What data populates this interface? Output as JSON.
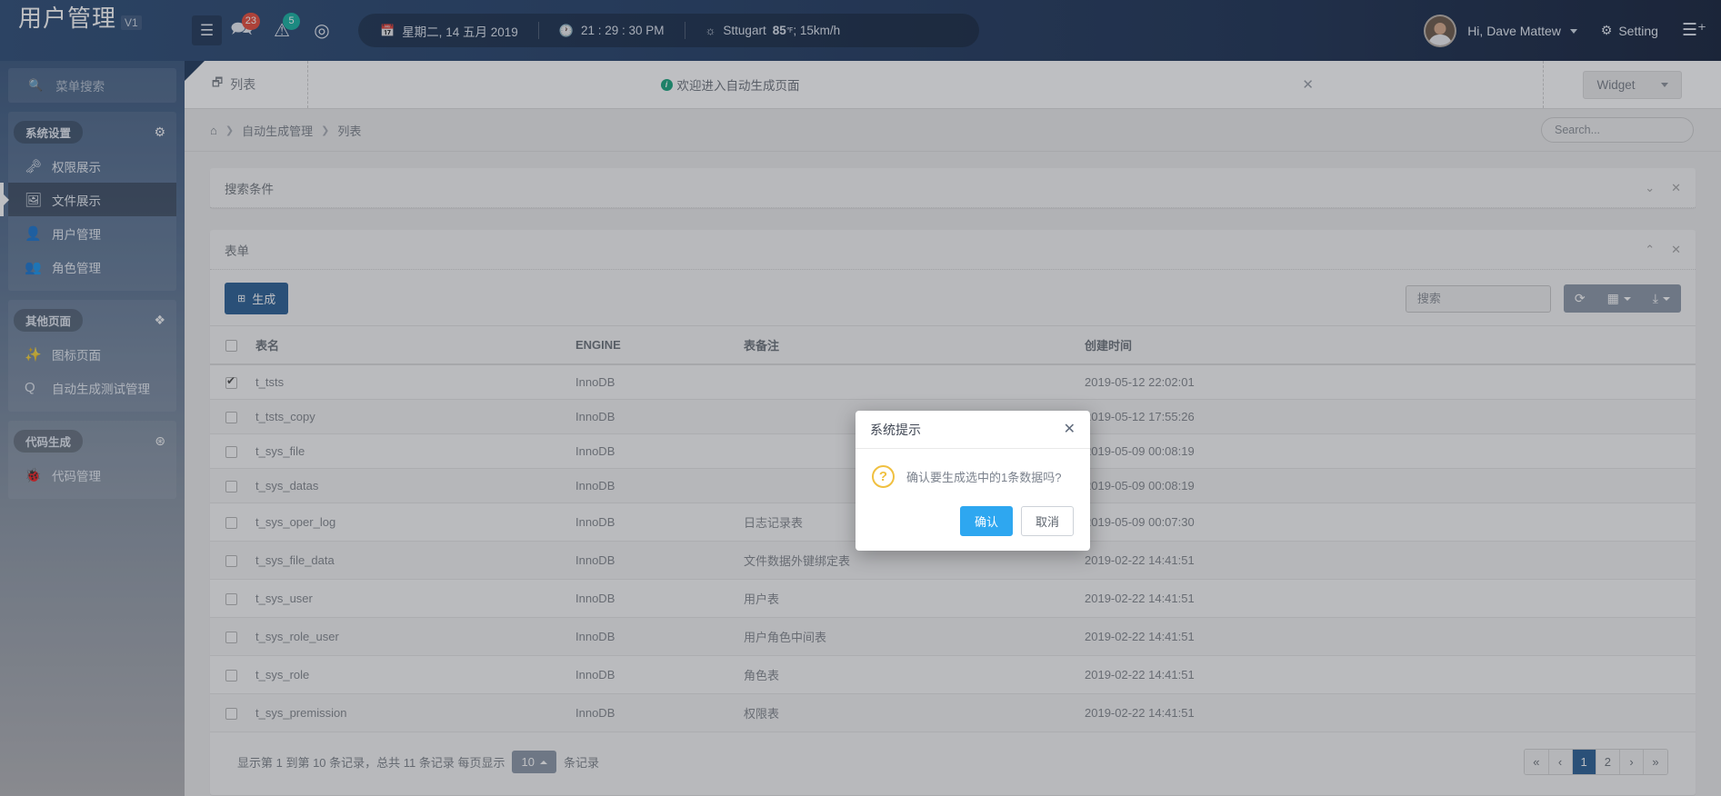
{
  "header": {
    "brand_title": "用户管理",
    "brand_version": "V1",
    "hamburger_icon": "hamburger-icon",
    "messages": {
      "icon": "comments-icon",
      "badge": "23"
    },
    "alerts": {
      "icon": "warning-triangle-icon",
      "badge": "5"
    },
    "settings_icon": "lifebuoy-icon",
    "info": {
      "date_icon": "calendar-icon",
      "date": "星期二, 14 五月 2019",
      "time_icon": "clock-icon",
      "time": "21 : 29 : 30 PM",
      "weather_icon": "sun-icon",
      "weather_city": "Sttugart",
      "weather_temp": "85",
      "weather_unit": "℉",
      "weather_wind": "; 15km/h"
    },
    "avatar_name": "avatar",
    "user_greeting": "Hi, Dave Mattew",
    "setting_label": "Setting",
    "setting_icon": "gear-icon",
    "plus_icon": "list-plus-icon"
  },
  "sidebar": {
    "search_placeholder": "菜单搜索",
    "search_icon": "menu-search-icon",
    "groups": [
      {
        "title": "系统设置",
        "icon": "gear-icon",
        "items": [
          {
            "label": "权限展示",
            "icon": "key-icon",
            "active": false
          },
          {
            "label": "文件展示",
            "icon": "file-image-icon",
            "active": true
          },
          {
            "label": "用户管理",
            "icon": "user-icon",
            "active": false
          },
          {
            "label": "角色管理",
            "icon": "users-icon",
            "active": false
          }
        ]
      },
      {
        "title": "其他页面",
        "icon": "windows-icon",
        "items": [
          {
            "label": "图标页面",
            "icon": "magic-wand-icon",
            "active": false
          },
          {
            "label": "自动生成测试管理",
            "icon": "quora-icon",
            "active": false
          }
        ]
      },
      {
        "title": "代码生成",
        "icon": "rebel-icon",
        "items": [
          {
            "label": "代码管理",
            "icon": "bug-icon",
            "active": false
          }
        ]
      }
    ]
  },
  "tabs": {
    "list_label": "列表",
    "list_icon": "window-icon",
    "welcome_text": "欢迎进入自动生成页面",
    "welcome_icon": "info-circle-icon",
    "close_icon": "close-icon",
    "widget_label": "Widget",
    "widget_caret_icon": "chevron-down-icon"
  },
  "breadcrumb": {
    "home_icon": "home-icon",
    "items": [
      "自动生成管理",
      "列表"
    ],
    "separator": "❯",
    "search_placeholder": "Search..."
  },
  "panels": {
    "search_conditions": {
      "title": "搜索条件",
      "collapse_icon": "chevron-down-icon",
      "close_icon": "close-icon"
    },
    "form": {
      "title": "表单",
      "collapse_icon": "chevron-up-icon",
      "close_icon": "close-icon"
    }
  },
  "toolbar": {
    "generate_label": "生成",
    "generate_icon": "plus-square-icon",
    "search_placeholder": "搜索",
    "refresh_icon": "refresh-icon",
    "columns_icon": "grid-icon",
    "export_icon": "download-icon",
    "caret_icon": "caret-down-icon"
  },
  "table": {
    "columns": [
      "表名",
      "ENGINE",
      "表备注",
      "创建时间"
    ],
    "select_all_checked": false,
    "rows": [
      {
        "checked": true,
        "name": "t_tsts",
        "engine": "InnoDB",
        "remark": "",
        "created": "2019-05-12 22:02:01"
      },
      {
        "checked": false,
        "name": "t_tsts_copy",
        "engine": "InnoDB",
        "remark": "",
        "created": "2019-05-12 17:55:26"
      },
      {
        "checked": false,
        "name": "t_sys_file",
        "engine": "InnoDB",
        "remark": "",
        "created": "2019-05-09 00:08:19"
      },
      {
        "checked": false,
        "name": "t_sys_datas",
        "engine": "InnoDB",
        "remark": "",
        "created": "2019-05-09 00:08:19"
      },
      {
        "checked": false,
        "name": "t_sys_oper_log",
        "engine": "InnoDB",
        "remark": "日志记录表",
        "created": "2019-05-09 00:07:30"
      },
      {
        "checked": false,
        "name": "t_sys_file_data",
        "engine": "InnoDB",
        "remark": "文件数据外键绑定表",
        "created": "2019-02-22 14:41:51"
      },
      {
        "checked": false,
        "name": "t_sys_user",
        "engine": "InnoDB",
        "remark": "用户表",
        "created": "2019-02-22 14:41:51"
      },
      {
        "checked": false,
        "name": "t_sys_role_user",
        "engine": "InnoDB",
        "remark": "用户角色中间表",
        "created": "2019-02-22 14:41:51"
      },
      {
        "checked": false,
        "name": "t_sys_role",
        "engine": "InnoDB",
        "remark": "角色表",
        "created": "2019-02-22 14:41:51"
      },
      {
        "checked": false,
        "name": "t_sys_premission",
        "engine": "InnoDB",
        "remark": "权限表",
        "created": "2019-02-22 14:41:51"
      }
    ]
  },
  "footer": {
    "info_prefix": "显示第 1 到第 10 条记录，总共 11 条记录 每页显示",
    "page_length": "10",
    "info_suffix": "条记录",
    "pager": {
      "first": "«",
      "prev": "‹",
      "pages": [
        "1",
        "2"
      ],
      "active_page": "1",
      "next": "›",
      "last": "»"
    }
  },
  "modal": {
    "title": "系统提示",
    "close_icon": "close-icon",
    "warn_icon": "question-mark-icon",
    "warn_glyph": "?",
    "message": "确认要生成选中的1条数据吗?",
    "ok_label": "确认",
    "cancel_label": "取消"
  },
  "colors": {
    "header_bg": "#26426a",
    "primary": "#2b6096",
    "modal_ok": "#2ea7f0",
    "badge_red": "#e74c3c",
    "badge_teal": "#17b3a3",
    "warn": "#f0c040"
  }
}
